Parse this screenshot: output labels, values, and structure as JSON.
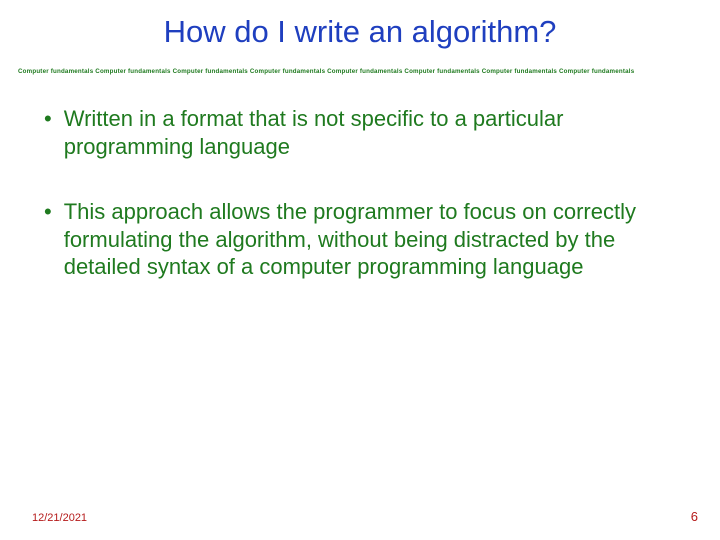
{
  "title": "How do I write an algorithm?",
  "ribbon": "Computer fundamentals Computer fundamentals Computer fundamentals Computer fundamentals Computer fundamentals Computer fundamentals Computer fundamentals Computer fundamentals",
  "bullets": [
    "Written in a format that is not specific to a particular programming language",
    "This approach allows the programmer to focus on correctly formulating the algorithm, without being distracted by the detailed syntax of a computer programming language"
  ],
  "footer": {
    "date": "12/21/2021",
    "page": "6"
  }
}
